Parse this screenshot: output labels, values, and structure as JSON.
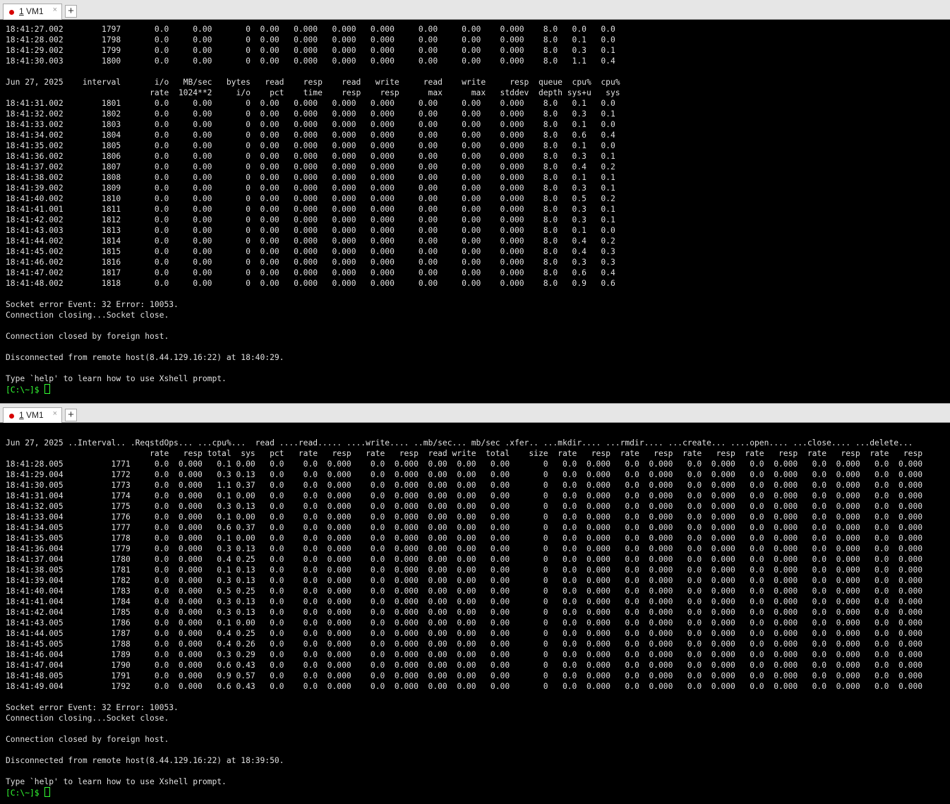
{
  "pane1": {
    "tab_number": "1",
    "tab_name": "VM1",
    "close_glyph": "×",
    "add_glyph": "+",
    "output": "18:41:27.002        1797       0.0     0.00       0  0.00   0.000   0.000   0.000     0.00     0.00    0.000    8.0   0.0   0.0\n18:41:28.002        1798       0.0     0.00       0  0.00   0.000   0.000   0.000     0.00     0.00    0.000    8.0   0.1   0.0\n18:41:29.002        1799       0.0     0.00       0  0.00   0.000   0.000   0.000     0.00     0.00    0.000    8.0   0.3   0.1\n18:41:30.003        1800       0.0     0.00       0  0.00   0.000   0.000   0.000     0.00     0.00    0.000    8.0   1.1   0.4\n\nJun 27, 2025    interval       i/o   MB/sec   bytes   read    resp    read   write     read    write     resp  queue  cpu%  cpu%\n                              rate  1024**2     i/o    pct    time    resp    resp      max      max   stddev  depth sys+u   sys\n18:41:31.002        1801       0.0     0.00       0  0.00   0.000   0.000   0.000     0.00     0.00    0.000    8.0   0.1   0.0\n18:41:32.002        1802       0.0     0.00       0  0.00   0.000   0.000   0.000     0.00     0.00    0.000    8.0   0.3   0.1\n18:41:33.002        1803       0.0     0.00       0  0.00   0.000   0.000   0.000     0.00     0.00    0.000    8.0   0.1   0.0\n18:41:34.002        1804       0.0     0.00       0  0.00   0.000   0.000   0.000     0.00     0.00    0.000    8.0   0.6   0.4\n18:41:35.002        1805       0.0     0.00       0  0.00   0.000   0.000   0.000     0.00     0.00    0.000    8.0   0.1   0.0\n18:41:36.002        1806       0.0     0.00       0  0.00   0.000   0.000   0.000     0.00     0.00    0.000    8.0   0.3   0.1\n18:41:37.002        1807       0.0     0.00       0  0.00   0.000   0.000   0.000     0.00     0.00    0.000    8.0   0.4   0.2\n18:41:38.002        1808       0.0     0.00       0  0.00   0.000   0.000   0.000     0.00     0.00    0.000    8.0   0.1   0.1\n18:41:39.002        1809       0.0     0.00       0  0.00   0.000   0.000   0.000     0.00     0.00    0.000    8.0   0.3   0.1\n18:41:40.002        1810       0.0     0.00       0  0.00   0.000   0.000   0.000     0.00     0.00    0.000    8.0   0.5   0.2\n18:41:41.001        1811       0.0     0.00       0  0.00   0.000   0.000   0.000     0.00     0.00    0.000    8.0   0.3   0.1\n18:41:42.002        1812       0.0     0.00       0  0.00   0.000   0.000   0.000     0.00     0.00    0.000    8.0   0.3   0.1\n18:41:43.003        1813       0.0     0.00       0  0.00   0.000   0.000   0.000     0.00     0.00    0.000    8.0   0.1   0.0\n18:41:44.002        1814       0.0     0.00       0  0.00   0.000   0.000   0.000     0.00     0.00    0.000    8.0   0.4   0.2\n18:41:45.002        1815       0.0     0.00       0  0.00   0.000   0.000   0.000     0.00     0.00    0.000    8.0   0.4   0.3\n18:41:46.002        1816       0.0     0.00       0  0.00   0.000   0.000   0.000     0.00     0.00    0.000    8.0   0.3   0.3\n18:41:47.002        1817       0.0     0.00       0  0.00   0.000   0.000   0.000     0.00     0.00    0.000    8.0   0.6   0.4\n18:41:48.002        1818       0.0     0.00       0  0.00   0.000   0.000   0.000     0.00     0.00    0.000    8.0   0.9   0.6\n\nSocket error Event: 32 Error: 10053.\nConnection closing...Socket close.\n\nConnection closed by foreign host.\n\nDisconnected from remote host(8.44.129.16:22) at 18:40:29.\n\nType `help' to learn how to use Xshell prompt.",
    "prompt": "[C:\\~]$ "
  },
  "pane2": {
    "tab_number": "1",
    "tab_name": "VM1",
    "close_glyph": "×",
    "add_glyph": "+",
    "output": "\nJun 27, 2025 ..Interval.. .ReqstdOps... ...cpu%...  read ....read..... ....write.... ..mb/sec... mb/sec .xfer.. ...mkdir.... ...rmdir.... ...create... ....open.... ...close.... ...delete...\n                              rate   resp total  sys   pct   rate   resp   rate   resp  read write  total    size  rate   resp  rate   resp  rate   resp  rate   resp  rate   resp  rate   resp\n18:41:28.005          1771     0.0  0.000   0.1 0.00   0.0    0.0  0.000    0.0  0.000  0.00  0.00   0.00       0   0.0  0.000   0.0  0.000   0.0  0.000   0.0  0.000   0.0  0.000   0.0  0.000\n18:41:29.004          1772     0.0  0.000   0.3 0.13   0.0    0.0  0.000    0.0  0.000  0.00  0.00   0.00       0   0.0  0.000   0.0  0.000   0.0  0.000   0.0  0.000   0.0  0.000   0.0  0.000\n18:41:30.005          1773     0.0  0.000   1.1 0.37   0.0    0.0  0.000    0.0  0.000  0.00  0.00   0.00       0   0.0  0.000   0.0  0.000   0.0  0.000   0.0  0.000   0.0  0.000   0.0  0.000\n18:41:31.004          1774     0.0  0.000   0.1 0.00   0.0    0.0  0.000    0.0  0.000  0.00  0.00   0.00       0   0.0  0.000   0.0  0.000   0.0  0.000   0.0  0.000   0.0  0.000   0.0  0.000\n18:41:32.005          1775     0.0  0.000   0.3 0.13   0.0    0.0  0.000    0.0  0.000  0.00  0.00   0.00       0   0.0  0.000   0.0  0.000   0.0  0.000   0.0  0.000   0.0  0.000   0.0  0.000\n18:41:33.004          1776     0.0  0.000   0.1 0.00   0.0    0.0  0.000    0.0  0.000  0.00  0.00   0.00       0   0.0  0.000   0.0  0.000   0.0  0.000   0.0  0.000   0.0  0.000   0.0  0.000\n18:41:34.005          1777     0.0  0.000   0.6 0.37   0.0    0.0  0.000    0.0  0.000  0.00  0.00   0.00       0   0.0  0.000   0.0  0.000   0.0  0.000   0.0  0.000   0.0  0.000   0.0  0.000\n18:41:35.005          1778     0.0  0.000   0.1 0.00   0.0    0.0  0.000    0.0  0.000  0.00  0.00   0.00       0   0.0  0.000   0.0  0.000   0.0  0.000   0.0  0.000   0.0  0.000   0.0  0.000\n18:41:36.004          1779     0.0  0.000   0.3 0.13   0.0    0.0  0.000    0.0  0.000  0.00  0.00   0.00       0   0.0  0.000   0.0  0.000   0.0  0.000   0.0  0.000   0.0  0.000   0.0  0.000\n18:41:37.004          1780     0.0  0.000   0.4 0.25   0.0    0.0  0.000    0.0  0.000  0.00  0.00   0.00       0   0.0  0.000   0.0  0.000   0.0  0.000   0.0  0.000   0.0  0.000   0.0  0.000\n18:41:38.005          1781     0.0  0.000   0.1 0.13   0.0    0.0  0.000    0.0  0.000  0.00  0.00   0.00       0   0.0  0.000   0.0  0.000   0.0  0.000   0.0  0.000   0.0  0.000   0.0  0.000\n18:41:39.004          1782     0.0  0.000   0.3 0.13   0.0    0.0  0.000    0.0  0.000  0.00  0.00   0.00       0   0.0  0.000   0.0  0.000   0.0  0.000   0.0  0.000   0.0  0.000   0.0  0.000\n18:41:40.004          1783     0.0  0.000   0.5 0.25   0.0    0.0  0.000    0.0  0.000  0.00  0.00   0.00       0   0.0  0.000   0.0  0.000   0.0  0.000   0.0  0.000   0.0  0.000   0.0  0.000\n18:41:41.004          1784     0.0  0.000   0.3 0.13   0.0    0.0  0.000    0.0  0.000  0.00  0.00   0.00       0   0.0  0.000   0.0  0.000   0.0  0.000   0.0  0.000   0.0  0.000   0.0  0.000\n18:41:42.004          1785     0.0  0.000   0.3 0.13   0.0    0.0  0.000    0.0  0.000  0.00  0.00   0.00       0   0.0  0.000   0.0  0.000   0.0  0.000   0.0  0.000   0.0  0.000   0.0  0.000\n18:41:43.005          1786     0.0  0.000   0.1 0.00   0.0    0.0  0.000    0.0  0.000  0.00  0.00   0.00       0   0.0  0.000   0.0  0.000   0.0  0.000   0.0  0.000   0.0  0.000   0.0  0.000\n18:41:44.005          1787     0.0  0.000   0.4 0.25   0.0    0.0  0.000    0.0  0.000  0.00  0.00   0.00       0   0.0  0.000   0.0  0.000   0.0  0.000   0.0  0.000   0.0  0.000   0.0  0.000\n18:41:45.005          1788     0.0  0.000   0.4 0.26   0.0    0.0  0.000    0.0  0.000  0.00  0.00   0.00       0   0.0  0.000   0.0  0.000   0.0  0.000   0.0  0.000   0.0  0.000   0.0  0.000\n18:41:46.004          1789     0.0  0.000   0.3 0.29   0.0    0.0  0.000    0.0  0.000  0.00  0.00   0.00       0   0.0  0.000   0.0  0.000   0.0  0.000   0.0  0.000   0.0  0.000   0.0  0.000\n18:41:47.004          1790     0.0  0.000   0.6 0.43   0.0    0.0  0.000    0.0  0.000  0.00  0.00   0.00       0   0.0  0.000   0.0  0.000   0.0  0.000   0.0  0.000   0.0  0.000   0.0  0.000\n18:41:48.005          1791     0.0  0.000   0.9 0.57   0.0    0.0  0.000    0.0  0.000  0.00  0.00   0.00       0   0.0  0.000   0.0  0.000   0.0  0.000   0.0  0.000   0.0  0.000   0.0  0.000\n18:41:49.004          1792     0.0  0.000   0.6 0.43   0.0    0.0  0.000    0.0  0.000  0.00  0.00   0.00       0   0.0  0.000   0.0  0.000   0.0  0.000   0.0  0.000   0.0  0.000   0.0  0.000\n\nSocket error Event: 32 Error: 10053.\nConnection closing...Socket close.\n\nConnection closed by foreign host.\n\nDisconnected from remote host(8.44.129.16:22) at 18:39:50.\n\nType `help' to learn how to use Xshell prompt.",
    "prompt": "[C:\\~]$ "
  },
  "colors": {
    "terminal_bg": "#000000",
    "terminal_fg": "#e0e0e0",
    "prompt": "#33ff33",
    "tab_dot": "#d60000"
  }
}
